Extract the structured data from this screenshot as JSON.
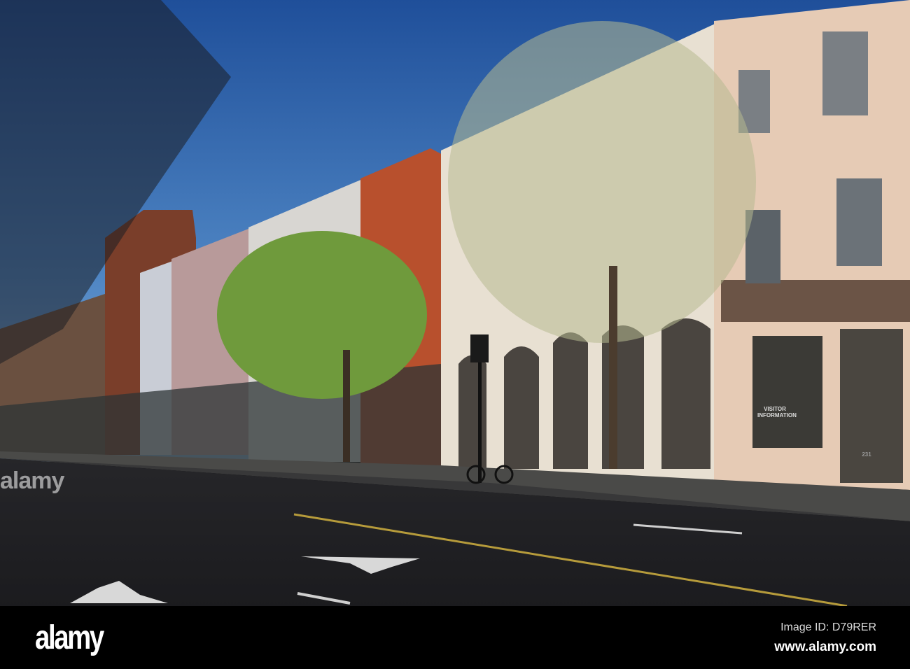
{
  "photo": {
    "signs": {
      "visitor_info": "VISITOR INFORMATION",
      "address": "231"
    },
    "watermark": "alamy"
  },
  "footer": {
    "logo": "alamy",
    "image_id": "Image ID: D79RER",
    "url": "www.alamy.com"
  }
}
